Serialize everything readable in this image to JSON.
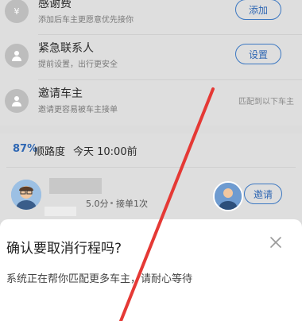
{
  "rows": [
    {
      "title": "感谢费",
      "sub": "添加后车主更愿意优先接你",
      "action": "添加",
      "icon": "yen-icon"
    },
    {
      "title": "紧急联系人",
      "sub": "提前设置，出行更安全",
      "action": "设置",
      "icon": "person-icon"
    },
    {
      "title": "邀请车主",
      "sub": "邀请更容易被车主接单",
      "note": "匹配到以下车主",
      "icon": "person-icon"
    }
  ],
  "match": {
    "percent": "87%",
    "route_label": "顺路度",
    "time": "今天 10:00前",
    "rating": "5.0分",
    "orders": "接单1次",
    "invite_label": "邀请"
  },
  "dialog": {
    "title": "确认要取消行程吗?",
    "message": "系统正在帮你匹配更多车主，请耐心等待",
    "close_icon": "close-icon"
  },
  "colors": {
    "accent": "#2f67b3",
    "annotation_arrow": "#e53935"
  }
}
